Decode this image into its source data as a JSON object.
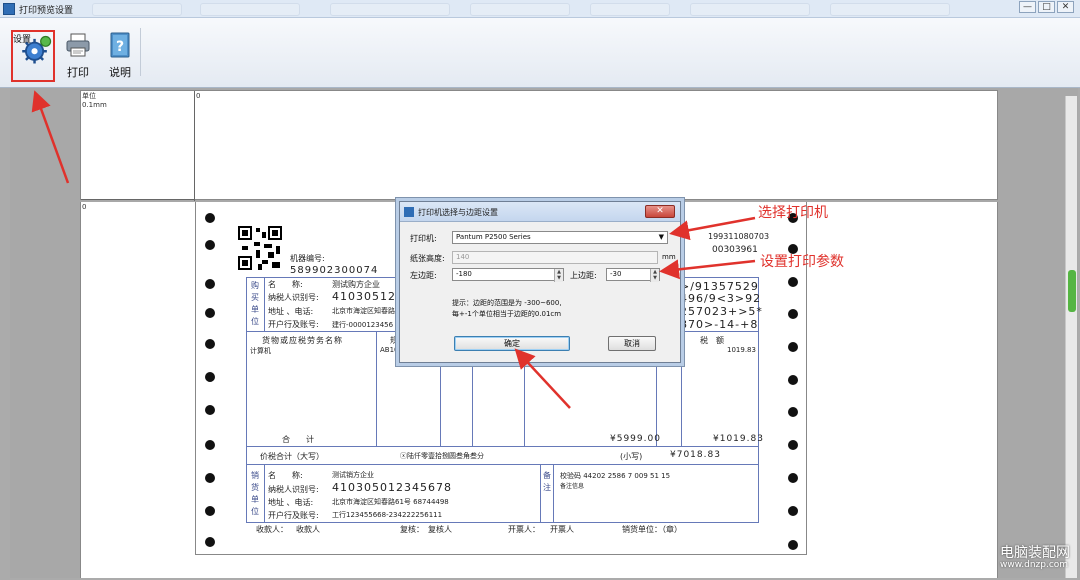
{
  "window": {
    "title": "打印预览设置",
    "controls": {
      "minimize": "—",
      "maximize": "□",
      "close": "✕"
    }
  },
  "toolbar": {
    "settings_label": "设置",
    "print_label": "打印",
    "help_label": "说明"
  },
  "paper": {
    "ruler_unit_label": "单位",
    "ruler_unit_value": "0.1mm",
    "ruler_zero_top": "0",
    "ruler_zero_left": "0"
  },
  "invoice": {
    "machine_no_label": "机器编号:",
    "machine_no_value": "589902300074",
    "right_code_1": "199311080703",
    "right_code_2": "00303961",
    "buyer_side_label": "购买单位",
    "buyer": {
      "name_label": "名　　称:",
      "name_value": "测试购方企业",
      "tax_label": "纳税人识别号:",
      "tax_value": "4103051234",
      "addr_label": "地址 、电话:",
      "addr_value": "北京市海淀区知春路",
      "bank_label": "开户行及账号:",
      "bank_value": "建行-0000123456"
    },
    "cipher_lines": [
      ">/91357529",
      "496/9<3>92",
      "257023+>5*",
      "870>-14-+8"
    ],
    "item_header_label": "货物或应税劳务名称",
    "item_header_partial": "规",
    "tax_header_label": "税　额",
    "item_name": "计算机",
    "item_spec": "AB100",
    "item_tax": "1019.83",
    "total_label": "合　　计",
    "total_amount": "¥5999.00",
    "total_tax": "¥1019.83",
    "price_tax_label": "价税合计（大写）",
    "price_tax_words": "ⓧ陆仟零壹拾捌圆叁角叁分",
    "small_label": "(小写)",
    "price_tax_figure": "¥7018.83",
    "seller_side_label": "销货单位",
    "seller": {
      "name_label": "名　　称:",
      "name_value": "测试销方企业",
      "tax_label": "纳税人识别号:",
      "tax_value": "410305012345678",
      "addr_label": "地址 、电话:",
      "addr_value": "北京市海淀区知春路61号 68744498",
      "bank_label": "开户行及账号:",
      "bank_value": "工行123455668-234222256111"
    },
    "remark_label": "备注",
    "check_code": "校验码 44202  2586 7 009 51 15",
    "remark_note": "备注信息",
    "receiver_label": "收款人：",
    "receiver_value": "收款人",
    "reviewer_label": "复核：",
    "reviewer_value": "复核人",
    "drawer_label": "开票人：",
    "drawer_value": "开票人",
    "seller_seal_label": "销货单位：（章）"
  },
  "dialog": {
    "title": "打印机选择与边距设置",
    "printer_label": "打印机:",
    "printer_value": "Pantum P2500 Series",
    "height_label": "纸张高度:",
    "height_value": "140",
    "height_unit": "mm",
    "left_margin_label": "左边距:",
    "left_margin_value": "-180",
    "top_margin_label": "上边距:",
    "top_margin_value": "-30",
    "hint_line_1": "提示：边距的范围是为 -300~600,",
    "hint_line_2": "每+-1个单位相当于边距的0.01cm",
    "ok_label": "确定",
    "cancel_label": "取消"
  },
  "annotations": {
    "select_printer": "选择打印机",
    "set_params": "设置打印参数",
    "color": "#e0322c"
  },
  "watermark": {
    "line_1": "电脑装配网",
    "line_2": "www.dnzp.com"
  }
}
